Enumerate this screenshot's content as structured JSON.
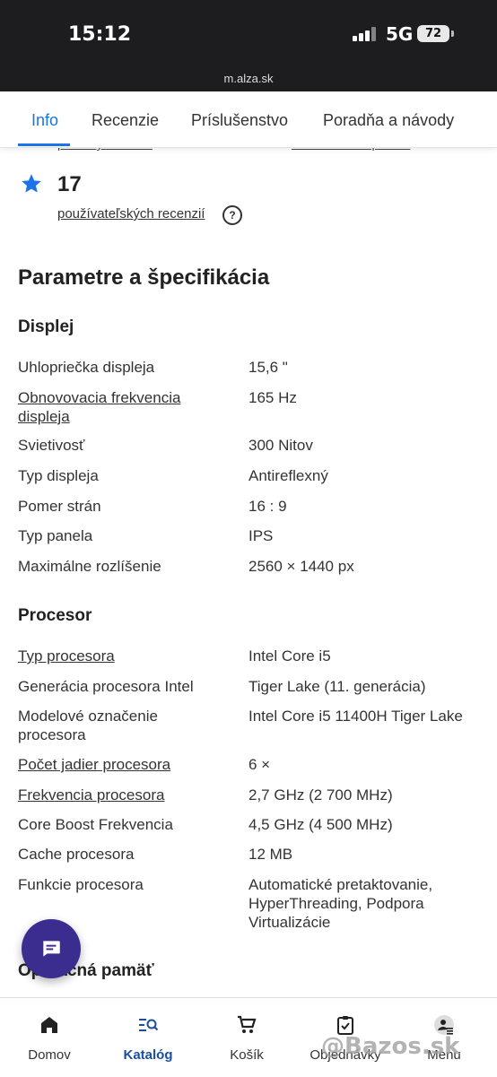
{
  "status": {
    "time": "15:12",
    "network": "5G",
    "battery": "72"
  },
  "browser": {
    "url": "m.alza.sk"
  },
  "tabs": [
    {
      "label": "Info"
    },
    {
      "label": "Recenzie"
    },
    {
      "label": "Príslušenstvo"
    },
    {
      "label": "Poradňa a návody"
    }
  ],
  "cut_row": {
    "left": "predaných kusov",
    "right": "zákazníkov odporúča"
  },
  "rating": {
    "count": "17",
    "reviews_link": "používateľských recenzií"
  },
  "section_title": "Parametre a špecifikácia",
  "groups": {
    "display": {
      "title": "Displej",
      "rows": [
        {
          "label": "Uhlopriečka displeja",
          "value": "15,6 \""
        },
        {
          "label": "Obnovovacia frekvencia displeja",
          "value": "165 Hz"
        },
        {
          "label": "Svietivosť",
          "value": "300 Nitov"
        },
        {
          "label": "Typ displeja",
          "value": "Antireflexný"
        },
        {
          "label": "Pomer strán",
          "value": "16 : 9"
        },
        {
          "label": "Typ panela",
          "value": "IPS"
        },
        {
          "label": "Maximálne rozlíšenie",
          "value": "2560 × 1440 px"
        }
      ]
    },
    "cpu": {
      "title": "Procesor",
      "rows": [
        {
          "label": "Typ procesora",
          "value": "Intel Core i5"
        },
        {
          "label": "Generácia procesora Intel",
          "value": "Tiger Lake (11. generácia)"
        },
        {
          "label": "Modelové označenie procesora",
          "value": "Intel Core i5 11400H Tiger Lake"
        },
        {
          "label": "Počet jadier procesora",
          "value": "6 ×"
        },
        {
          "label": "Frekvencia procesora",
          "value": "2,7 GHz (2 700 MHz)"
        },
        {
          "label": "Core Boost Frekvencia",
          "value": "4,5 GHz (4 500 MHz)"
        },
        {
          "label": "Cache procesora",
          "value": "12 MB"
        },
        {
          "label": "Funkcie procesora",
          "value": "Automatické pretaktovanie, HyperThreading, Podpora Virtualizácie"
        }
      ]
    },
    "memory": {
      "title": "Operačná pamäť"
    }
  },
  "bottom_nav": [
    {
      "label": "Domov"
    },
    {
      "label": "Katalóg"
    },
    {
      "label": "Košík"
    },
    {
      "label": "Objednávky"
    },
    {
      "label": "Menu"
    }
  ],
  "watermark": "@Bazos.sk",
  "colors": {
    "accent": "#1a73e8",
    "fab": "#3b2c8f",
    "status_bar": "#1d1d1f"
  }
}
